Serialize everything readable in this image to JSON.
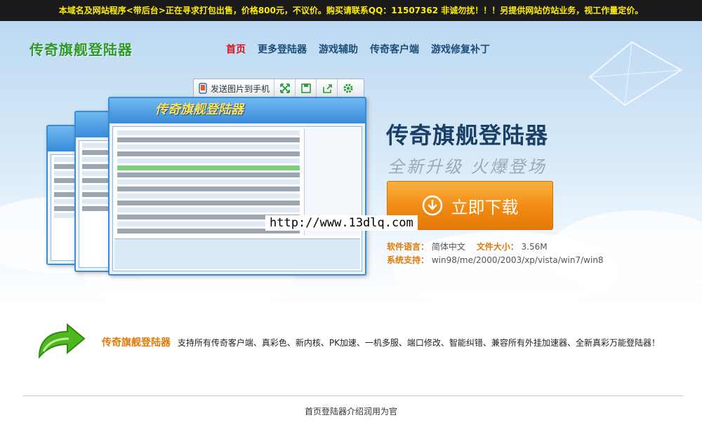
{
  "notice": "本域名及网站程序<带后台>正在寻求打包出售，价格800元，不议价。购买请联系QQ：11507362 非诚勿扰！！！另提供网站仿站业务，视工作量定价。",
  "logo": "传奇旗舰登陆器",
  "nav": [
    "首页",
    "更多登陆器",
    "游戏辅助",
    "传奇客户端",
    "游戏修复补丁"
  ],
  "toolbar": {
    "send_label": "发送图片到手机"
  },
  "screenshot": {
    "banner": "传奇旗舰登陆器"
  },
  "hero": {
    "title": "传奇旗舰登陆器",
    "slogan": "全新升级 火爆登场",
    "download_label": "立即下载",
    "url_overlay": "http://www.13dlq.com"
  },
  "info": {
    "lang_label": "软件语言：",
    "lang_value": "简体中文",
    "size_label": "文件大小：",
    "size_value": "3.56M",
    "sys_label": "系统支持：",
    "sys_value": "win98/me/2000/2003/xp/vista/win7/win8"
  },
  "description": {
    "brand": "传奇旗舰登陆器",
    "text": "支持所有传奇客户端、真彩色、新内核、PK加速、一机多服、端口修改、智能纠错、兼容所有外挂加速器、全新真彩万能登陆器！"
  },
  "footer": "首页登陆器介绍润用为官",
  "colors": {
    "notice_bg": "#1a1a1a",
    "notice_text": "#ffee00",
    "accent_orange": "#f08a12",
    "brand_green": "#2a9a2a"
  }
}
